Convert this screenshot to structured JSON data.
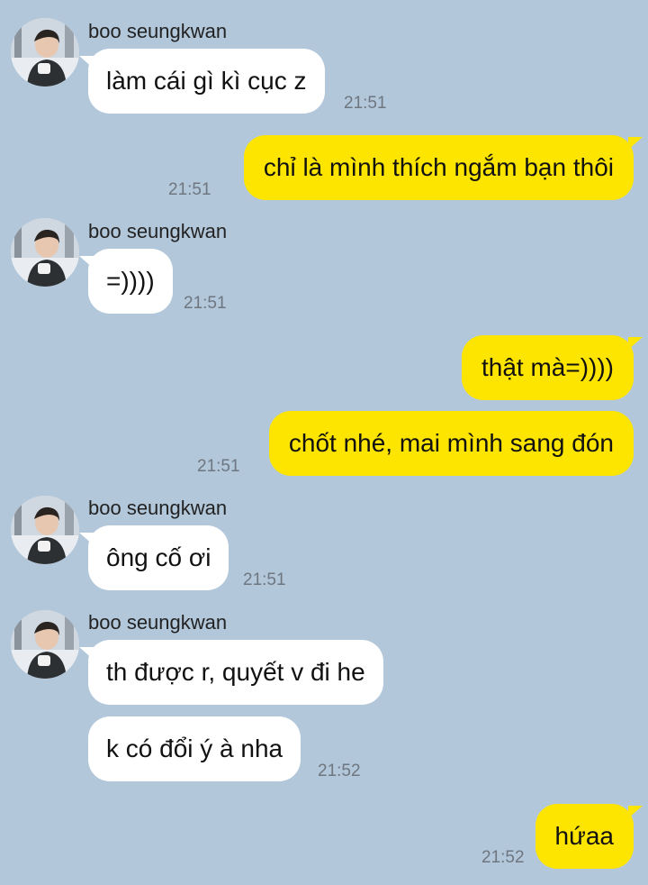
{
  "colors": {
    "background": "#b2c7da",
    "incoming_bubble": "#ffffff",
    "outgoing_bubble": "#fee500",
    "time_text": "#6e7680"
  },
  "messages": [
    {
      "sender": "boo seungkwan",
      "text": "làm cái gì kì cục z",
      "time": "21:51"
    },
    {
      "text": "chỉ là mình thích ngắm bạn thôi",
      "time": "21:51"
    },
    {
      "sender": "boo seungkwan",
      "text": "=))))",
      "time": "21:51"
    },
    {
      "text": "thật mà=))))"
    },
    {
      "text": "chốt nhé, mai mình sang đón",
      "time": "21:51"
    },
    {
      "sender": "boo seungkwan",
      "text": "ông cố ơi",
      "time": "21:51"
    },
    {
      "sender": "boo seungkwan",
      "text": "th được r, quyết v đi he"
    },
    {
      "text": "k có đổi ý à nha",
      "time": "21:52"
    },
    {
      "text": "hứaa",
      "time": "21:52"
    }
  ]
}
